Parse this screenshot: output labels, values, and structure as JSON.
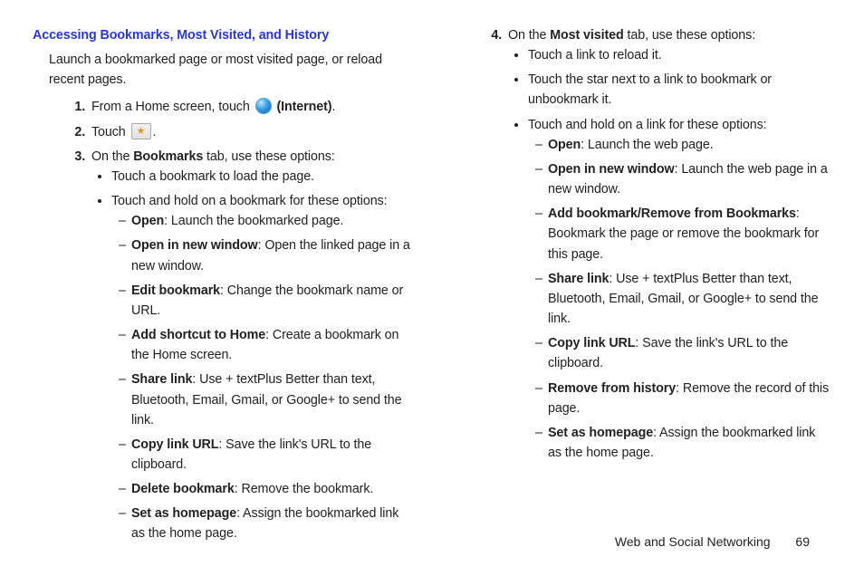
{
  "section_title": "Accessing Bookmarks, Most Visited, and History",
  "intro": "Launch a bookmarked page or most visited page, or reload recent pages.",
  "steps": {
    "1": {
      "pre": "From a Home screen, touch ",
      "icon": "internet-icon",
      "label": "(Internet)",
      "post": "."
    },
    "2": {
      "pre": "Touch ",
      "icon": "bookmarks-icon",
      "post": "."
    },
    "3": {
      "text_pre": "On the ",
      "bold": "Bookmarks",
      "text_post": " tab, use these options:",
      "bullets": [
        "Touch a bookmark to load the page.",
        "Touch and hold on a bookmark for these options:"
      ],
      "dashes": [
        {
          "bold": "Open",
          "rest": ": Launch the bookmarked page."
        },
        {
          "bold": "Open in new window",
          "rest": ": Open the linked page in a new window."
        },
        {
          "bold": "Edit bookmark",
          "rest": ": Change the bookmark name or URL."
        },
        {
          "bold": "Add shortcut to Home",
          "rest": ": Create a bookmark on the Home screen."
        },
        {
          "bold": "Share link",
          "rest": ": Use + textPlus Better than text, Bluetooth, Email, Gmail, or Google+ to send the link."
        },
        {
          "bold": "Copy link URL",
          "rest": ": Save the link's URL to the clipboard."
        },
        {
          "bold": "Delete bookmark",
          "rest": ": Remove the bookmark."
        },
        {
          "bold": "Set as homepage",
          "rest": ": Assign the bookmarked link as the home page."
        }
      ]
    },
    "4": {
      "text_pre": "On the ",
      "bold": "Most visited",
      "text_post": " tab, use these options:",
      "bullets": [
        "Touch a link to reload it.",
        "Touch the star next to a link to bookmark or unbookmark it.",
        "Touch and hold on a link for these options:"
      ],
      "dashes": [
        {
          "bold": "Open",
          "rest": ": Launch the web page."
        },
        {
          "bold": "Open in new window",
          "rest": ": Launch the web page in a new window."
        },
        {
          "bold": "Add bookmark/Remove from Bookmarks",
          "rest": ": Bookmark the page or remove the bookmark for this page."
        },
        {
          "bold": "Share link",
          "rest": ": Use + textPlus Better than text, Bluetooth, Email, Gmail, or Google+  to send the link."
        },
        {
          "bold": "Copy link URL",
          "rest": ": Save the link's URL to the clipboard."
        },
        {
          "bold": "Remove from history",
          "rest": ": Remove the record of this page."
        },
        {
          "bold": "Set as homepage",
          "rest": ": Assign the bookmarked link as the home page."
        }
      ]
    }
  },
  "footer": {
    "section": "Web and Social Networking",
    "page": "69"
  }
}
